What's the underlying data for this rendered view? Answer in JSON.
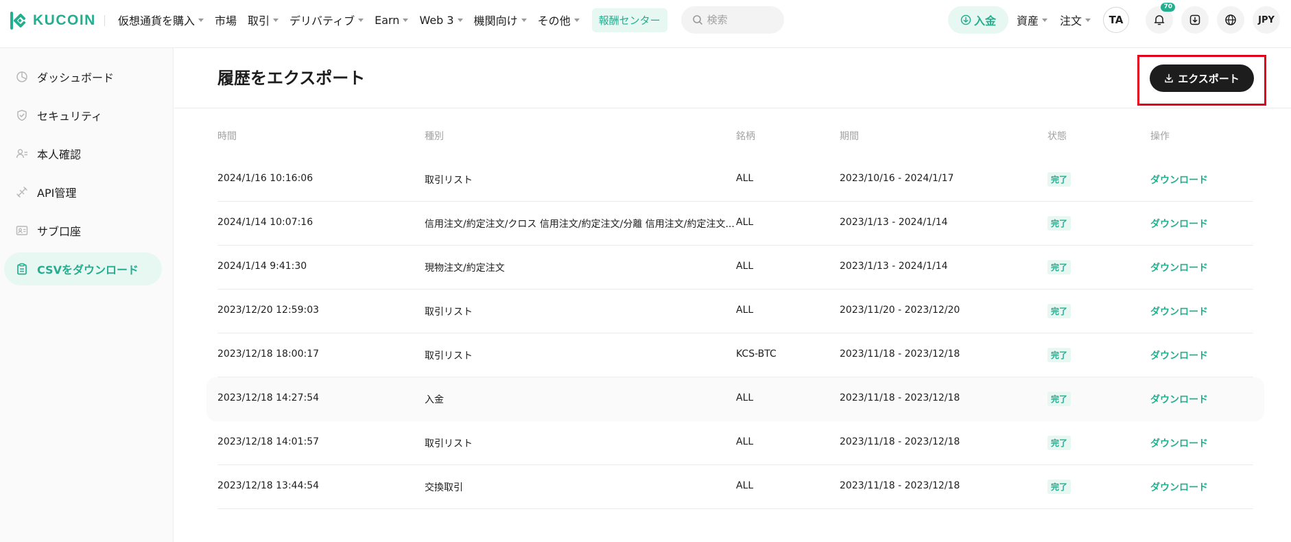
{
  "brand": {
    "name": "KUCOIN",
    "accent": "#24ae8f"
  },
  "nav": {
    "menu": [
      {
        "label": "仮想通貨を購入",
        "caret": true
      },
      {
        "label": "市場",
        "caret": false
      },
      {
        "label": "取引",
        "caret": true
      },
      {
        "label": "デリバティブ",
        "caret": true
      },
      {
        "label": "Earn",
        "caret": true
      },
      {
        "label": "Web 3",
        "caret": true
      },
      {
        "label": "機関向け",
        "caret": true
      },
      {
        "label": "その他",
        "caret": true
      }
    ],
    "reward_center": "報酬センター",
    "search_placeholder": "検索",
    "deposit": "入金",
    "assets": "資産",
    "orders": "注文",
    "avatar": "TA",
    "notification_count": "70",
    "currency": "JPY"
  },
  "sidebar": {
    "items": [
      {
        "label": "ダッシュボード",
        "icon": "dashboard-icon",
        "active": false
      },
      {
        "label": "セキュリティ",
        "icon": "shield-icon",
        "active": false
      },
      {
        "label": "本人確認",
        "icon": "user-id-icon",
        "active": false
      },
      {
        "label": "API管理",
        "icon": "api-icon",
        "active": false
      },
      {
        "label": "サブ口座",
        "icon": "sub-account-icon",
        "active": false
      },
      {
        "label": "CSVをダウンロード",
        "icon": "clipboard-icon",
        "active": true
      }
    ]
  },
  "page": {
    "title": "履歴をエクスポート",
    "export_button": "エクスポート"
  },
  "table": {
    "columns": [
      "時間",
      "種別",
      "銘柄",
      "期間",
      "状態",
      "操作"
    ],
    "rows": [
      {
        "time": "2024/1/16 10:16:06",
        "type": "取引リスト",
        "symbol": "ALL",
        "period": "2023/10/16 - 2024/1/17",
        "status": "完了",
        "action": "ダウンロード"
      },
      {
        "time": "2024/1/14 10:07:16",
        "type": "信用注文/約定注文/クロス 信用注文/約定注文/分離 信用注文/約定注文...",
        "symbol": "ALL",
        "period": "2023/1/13 - 2024/1/14",
        "status": "完了",
        "action": "ダウンロード"
      },
      {
        "time": "2024/1/14 9:41:30",
        "type": "現物注文/約定注文",
        "symbol": "ALL",
        "period": "2023/1/13 - 2024/1/14",
        "status": "完了",
        "action": "ダウンロード"
      },
      {
        "time": "2023/12/20 12:59:03",
        "type": "取引リスト",
        "symbol": "ALL",
        "period": "2023/11/20 - 2023/12/20",
        "status": "完了",
        "action": "ダウンロード"
      },
      {
        "time": "2023/12/18 18:00:17",
        "type": "取引リスト",
        "symbol": "KCS-BTC",
        "period": "2023/11/18 - 2023/12/18",
        "status": "完了",
        "action": "ダウンロード"
      },
      {
        "time": "2023/12/18 14:27:54",
        "type": "入金",
        "symbol": "ALL",
        "period": "2023/11/18 - 2023/12/18",
        "status": "完了",
        "action": "ダウンロード"
      },
      {
        "time": "2023/12/18 14:01:57",
        "type": "取引リスト",
        "symbol": "ALL",
        "period": "2023/11/18 - 2023/12/18",
        "status": "完了",
        "action": "ダウンロード"
      },
      {
        "time": "2023/12/18 13:44:54",
        "type": "交換取引",
        "symbol": "ALL",
        "period": "2023/11/18 - 2023/12/18",
        "status": "完了",
        "action": "ダウンロード"
      }
    ]
  }
}
